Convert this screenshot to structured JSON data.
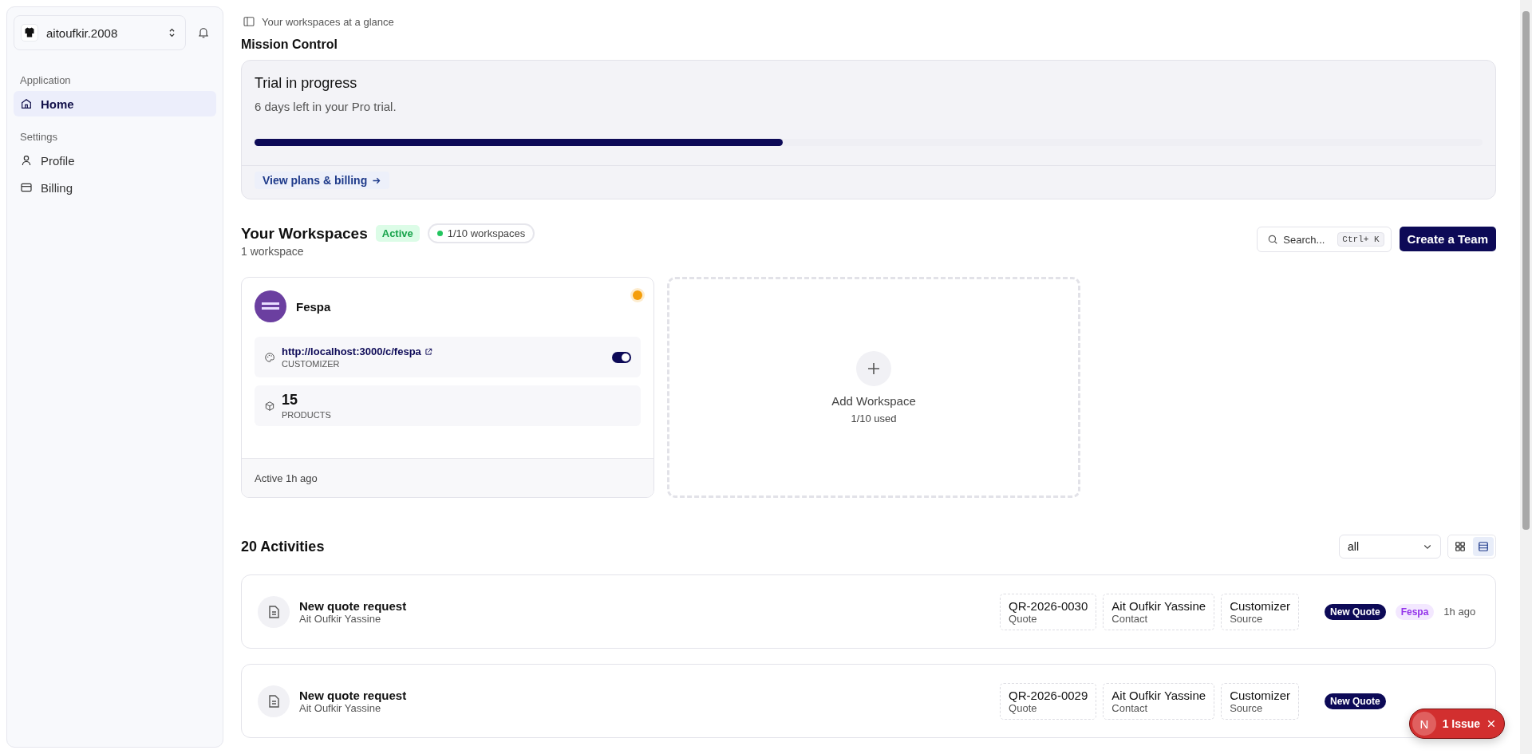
{
  "sidebar": {
    "account": {
      "name": "aitoufkir.2008"
    },
    "sections": [
      {
        "label": "Application",
        "items": [
          {
            "label": "Home",
            "kind": "home",
            "selected": true
          }
        ]
      },
      {
        "label": "Settings",
        "items": [
          {
            "label": "Profile",
            "kind": "user",
            "selected": false
          },
          {
            "label": "Billing",
            "kind": "card",
            "selected": false
          }
        ]
      }
    ]
  },
  "header": {
    "subtitle": "Your workspaces at a glance",
    "title": "Mission Control"
  },
  "trial": {
    "title": "Trial in progress",
    "subtitle": "6 days left in your Pro trial.",
    "level": 0.43,
    "link": "View plans & billing"
  },
  "workspaces": {
    "title": "Your Workspaces",
    "count": "1 workspace",
    "status": "Active",
    "usage": "1/10 workspaces",
    "search": {
      "placeholder": "Search...",
      "shortcut": "Ctrl+ K"
    },
    "create_button": "Create a Team",
    "items": [
      {
        "name": "Fespa",
        "color": "#f59e0b",
        "url": "http://localhost:3000/c/fespa",
        "url_label": "CUSTOMIZER",
        "customizer_on": true,
        "products": "15",
        "products_label": "PRODUCTS",
        "last_active": "Active 1h ago"
      }
    ],
    "add": {
      "label": "Add Workspace",
      "usage": "1/10 used"
    }
  },
  "activities": {
    "title": "20 Activities",
    "filter": "all",
    "views": [
      {
        "kind": "grid",
        "selected": false
      },
      {
        "kind": "list",
        "selected": true
      }
    ],
    "rows": [
      {
        "title": "New quote request",
        "person": "Ait Oufkir Yassine",
        "fields": [
          {
            "value": "QR-2026-0030",
            "label": "Quote"
          },
          {
            "value": "Ait Oufkir Yassine",
            "label": "Contact"
          },
          {
            "value": "Customizer",
            "label": "Source"
          }
        ],
        "tags": [
          {
            "label": "New Quote",
            "kind": "type"
          },
          {
            "label": "Fespa",
            "kind": "workspace"
          }
        ],
        "time": "1h ago"
      },
      {
        "title": "New quote request",
        "person": "Ait Oufkir Yassine",
        "fields": [
          {
            "value": "QR-2026-0029",
            "label": "Quote"
          },
          {
            "value": "Ait Oufkir Yassine",
            "label": "Contact"
          },
          {
            "value": "Customizer",
            "label": "Source"
          }
        ],
        "tags": [
          {
            "label": "New Quote",
            "kind": "type"
          }
        ]
      }
    ]
  },
  "toast": {
    "avatar": "N",
    "label": "1 Issue"
  }
}
